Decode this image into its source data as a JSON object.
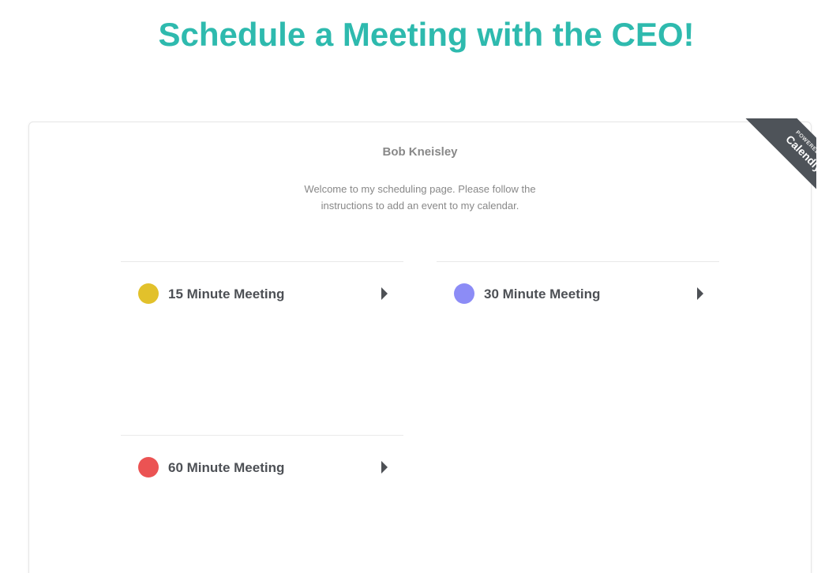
{
  "page": {
    "title": "Schedule a Meeting with the CEO!"
  },
  "profile": {
    "name": "Bob Kneisley",
    "welcome": "Welcome to my scheduling page. Please follow the instructions to add an event to my calendar."
  },
  "events": [
    {
      "label": "15 Minute Meeting",
      "color": "#e2c12b"
    },
    {
      "label": "30 Minute Meeting",
      "color": "#8c8cf6"
    },
    {
      "label": "60 Minute Meeting",
      "color": "#eb5353"
    }
  ],
  "badge": {
    "small": "POWERED BY",
    "big": "Calendly"
  },
  "colors": {
    "accent": "#2ebaae",
    "ribbon": "#4e5359",
    "text": "#4d5055",
    "muted": "#888888"
  }
}
